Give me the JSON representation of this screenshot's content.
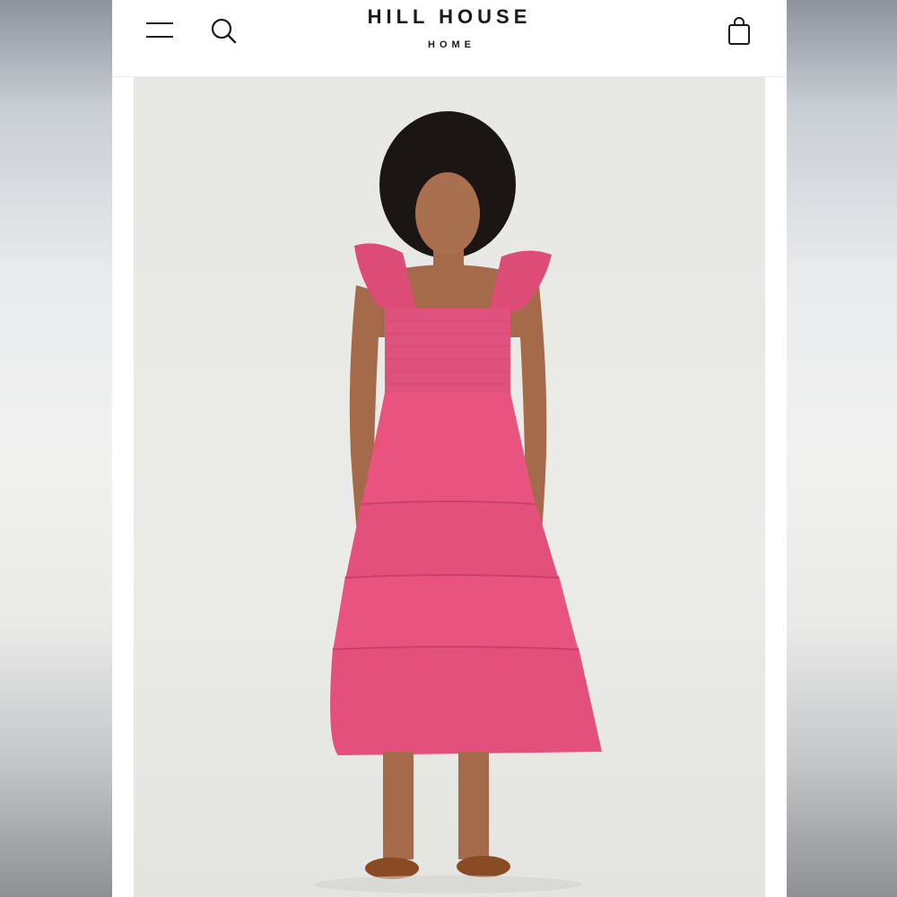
{
  "header": {
    "brand_name": "HILL HOUSE",
    "brand_sub": "HOME",
    "icons": {
      "menu": "hamburger-menu-icon",
      "search": "search-icon",
      "cart": "shopping-bag-icon"
    }
  },
  "product": {
    "image": "model-wearing-pink-tiered-smocked-midi-dress",
    "dress_color": "#e8537f"
  }
}
